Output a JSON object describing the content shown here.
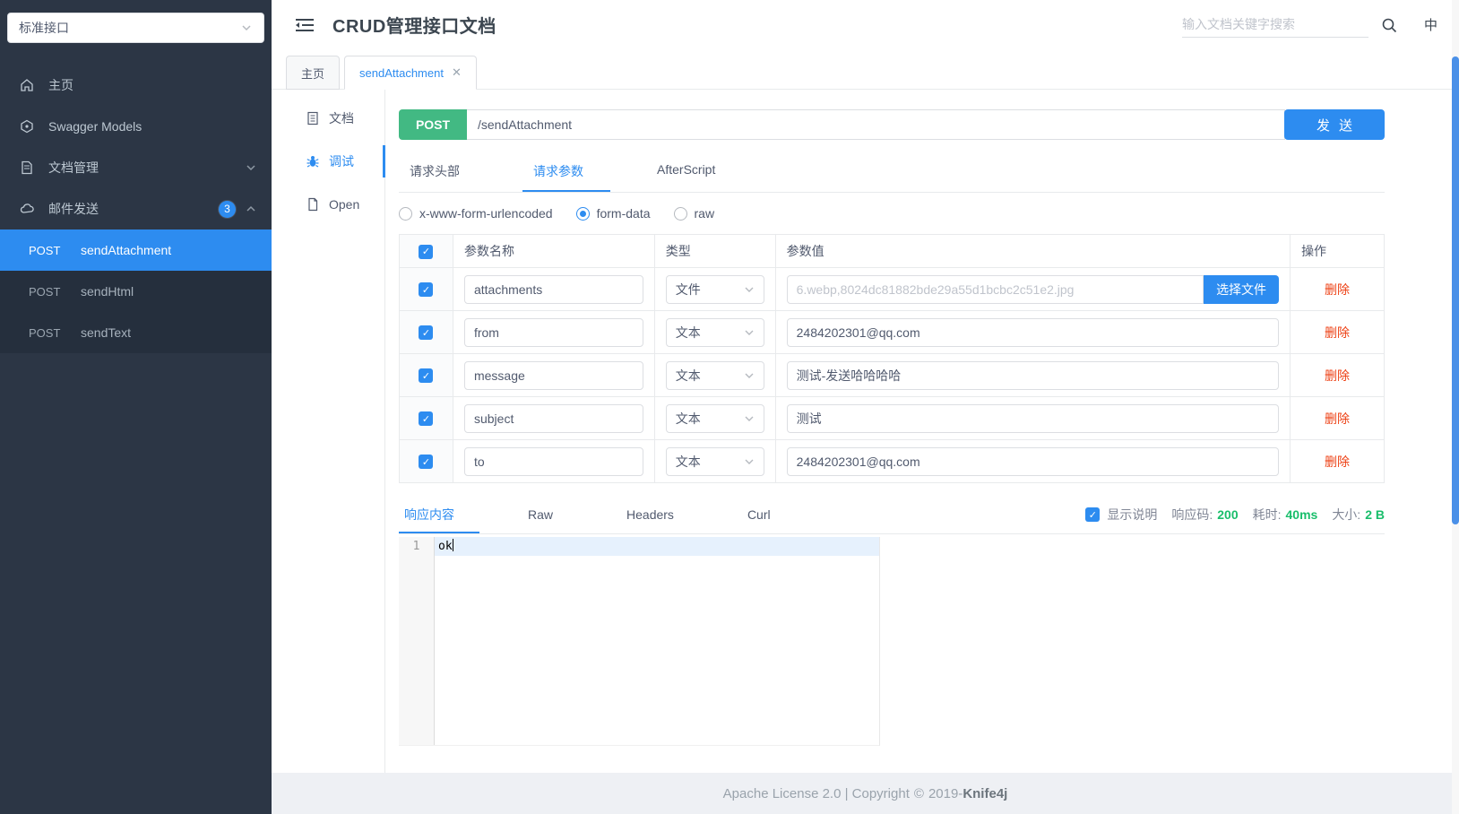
{
  "colors": {
    "primary": "#2d8cf0",
    "post_green": "#42b983",
    "success": "#19be6b",
    "danger": "#ed4014",
    "sidebar_bg": "#2c3645",
    "footer_bg": "#eef0f4"
  },
  "sidebar": {
    "group_select": "标准接口",
    "items": [
      {
        "icon": "home-icon",
        "label": "主页"
      },
      {
        "icon": "swagger-models-icon",
        "label": "Swagger Models"
      },
      {
        "icon": "document-manage-icon",
        "label": "文档管理",
        "chevron": "down"
      },
      {
        "icon": "mail-send-icon",
        "label": "邮件发送",
        "badge": "3",
        "chevron": "up"
      }
    ],
    "apis": [
      {
        "method": "POST",
        "name": "sendAttachment",
        "selected": true
      },
      {
        "method": "POST",
        "name": "sendHtml",
        "selected": false
      },
      {
        "method": "POST",
        "name": "sendText",
        "selected": false
      }
    ]
  },
  "header": {
    "title": "CRUD管理接口文档",
    "search_placeholder": "输入文档关键字搜索",
    "lang": "中"
  },
  "tabs": [
    {
      "label": "主页",
      "active": false,
      "closable": false
    },
    {
      "label": "sendAttachment",
      "active": true,
      "closable": true,
      "close_glyph": "✕"
    }
  ],
  "doc_nav": [
    {
      "icon": "doc-icon",
      "label": "文档",
      "active": false
    },
    {
      "icon": "bug-icon",
      "label": "调试",
      "active": true
    },
    {
      "icon": "open-icon",
      "label": "Open",
      "active": false
    }
  ],
  "debug": {
    "method": "POST",
    "url": "/sendAttachment",
    "send_label": "发送",
    "request_tabs": [
      {
        "label": "请求头部",
        "active": false
      },
      {
        "label": "请求参数",
        "active": true
      },
      {
        "label": "AfterScript",
        "active": false
      }
    ],
    "body_types": [
      {
        "label": "x-www-form-urlencoded",
        "selected": false
      },
      {
        "label": "form-data",
        "selected": true
      },
      {
        "label": "raw",
        "selected": false
      }
    ],
    "table": {
      "headers": {
        "name": "参数名称",
        "type": "类型",
        "value": "参数值",
        "action": "操作"
      },
      "file_button": "选择文件",
      "delete_label": "删除",
      "rows": [
        {
          "checked": true,
          "name": "attachments",
          "type": "文件",
          "value": "6.webp,8024dc81882bde29a55d1bcbc2c51e2.jpg",
          "is_file": true
        },
        {
          "checked": true,
          "name": "from",
          "type": "文本",
          "value": "2484202301@qq.com",
          "is_file": false
        },
        {
          "checked": true,
          "name": "message",
          "type": "文本",
          "value": "测试-发送哈哈哈哈",
          "is_file": false
        },
        {
          "checked": true,
          "name": "subject",
          "type": "文本",
          "value": "测试",
          "is_file": false
        },
        {
          "checked": true,
          "name": "to",
          "type": "文本",
          "value": "2484202301@qq.com",
          "is_file": false
        }
      ]
    },
    "response_tabs": [
      {
        "label": "响应内容",
        "active": true
      },
      {
        "label": "Raw",
        "active": false
      },
      {
        "label": "Headers",
        "active": false
      },
      {
        "label": "Curl",
        "active": false
      }
    ],
    "meta": {
      "show_desc_label": "显示说明",
      "show_desc_checked": true,
      "code_label": "响应码:",
      "code": "200",
      "time_label": "耗时:",
      "time": "40ms",
      "size_label": "大小:",
      "size": "2 B"
    },
    "editor": {
      "line_number": "1",
      "content": "ok"
    }
  },
  "footer": {
    "text": "Apache License 2.0 | Copyright",
    "copyright_symbol": "©",
    "year_prefix": "2019-",
    "brand": "Knife4j"
  }
}
